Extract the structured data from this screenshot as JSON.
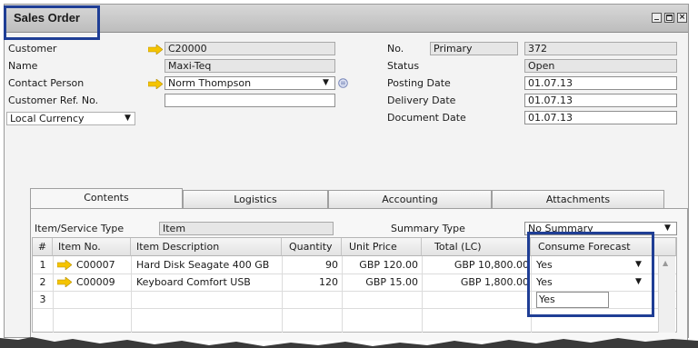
{
  "window": {
    "title": "Sales Order"
  },
  "header_left": {
    "customer": {
      "label": "Customer",
      "value": "C20000"
    },
    "name": {
      "label": "Name",
      "value": "Maxi-Teq"
    },
    "contact": {
      "label": "Contact Person",
      "value": "Norm Thompson"
    },
    "ref": {
      "label": "Customer Ref. No.",
      "value": ""
    },
    "currency": {
      "value": "Local Currency"
    }
  },
  "header_right": {
    "no": {
      "label": "No.",
      "series": "Primary",
      "value": "372"
    },
    "status": {
      "label": "Status",
      "value": "Open"
    },
    "posting": {
      "label": "Posting Date",
      "value": "01.07.13"
    },
    "delivery": {
      "label": "Delivery Date",
      "value": "01.07.13"
    },
    "document": {
      "label": "Document Date",
      "value": "01.07.13"
    }
  },
  "tabs": [
    {
      "label": "Contents"
    },
    {
      "label": "Logistics"
    },
    {
      "label": "Accounting"
    },
    {
      "label": "Attachments"
    }
  ],
  "contents": {
    "item_type": {
      "label": "Item/Service Type",
      "value": "Item"
    },
    "summary_type": {
      "label": "Summary Type",
      "value": "No Summary"
    }
  },
  "grid": {
    "columns": [
      "#",
      "Item No.",
      "Item Description",
      "Quantity",
      "Unit Price",
      "Total (LC)",
      "Consume Forecast"
    ],
    "rows": [
      {
        "n": "1",
        "item_no": "C00007",
        "desc": "Hard Disk Seagate 400 GB",
        "qty": "90",
        "price": "GBP 120.00",
        "total": "GBP 10,800.00",
        "forecast": "Yes"
      },
      {
        "n": "2",
        "item_no": "C00009",
        "desc": "Keyboard Comfort USB",
        "qty": "120",
        "price": "GBP 15.00",
        "total": "GBP 1,800.00",
        "forecast": "Yes"
      },
      {
        "n": "3",
        "forecast_option": "Yes"
      }
    ]
  },
  "colors": {
    "highlight": "#1f3e95",
    "link_arrow": "#f5c400"
  },
  "icons": [
    "link-arrow-icon",
    "dropdown-arrow-icon",
    "minimize-icon",
    "maximize-icon",
    "close-icon"
  ]
}
